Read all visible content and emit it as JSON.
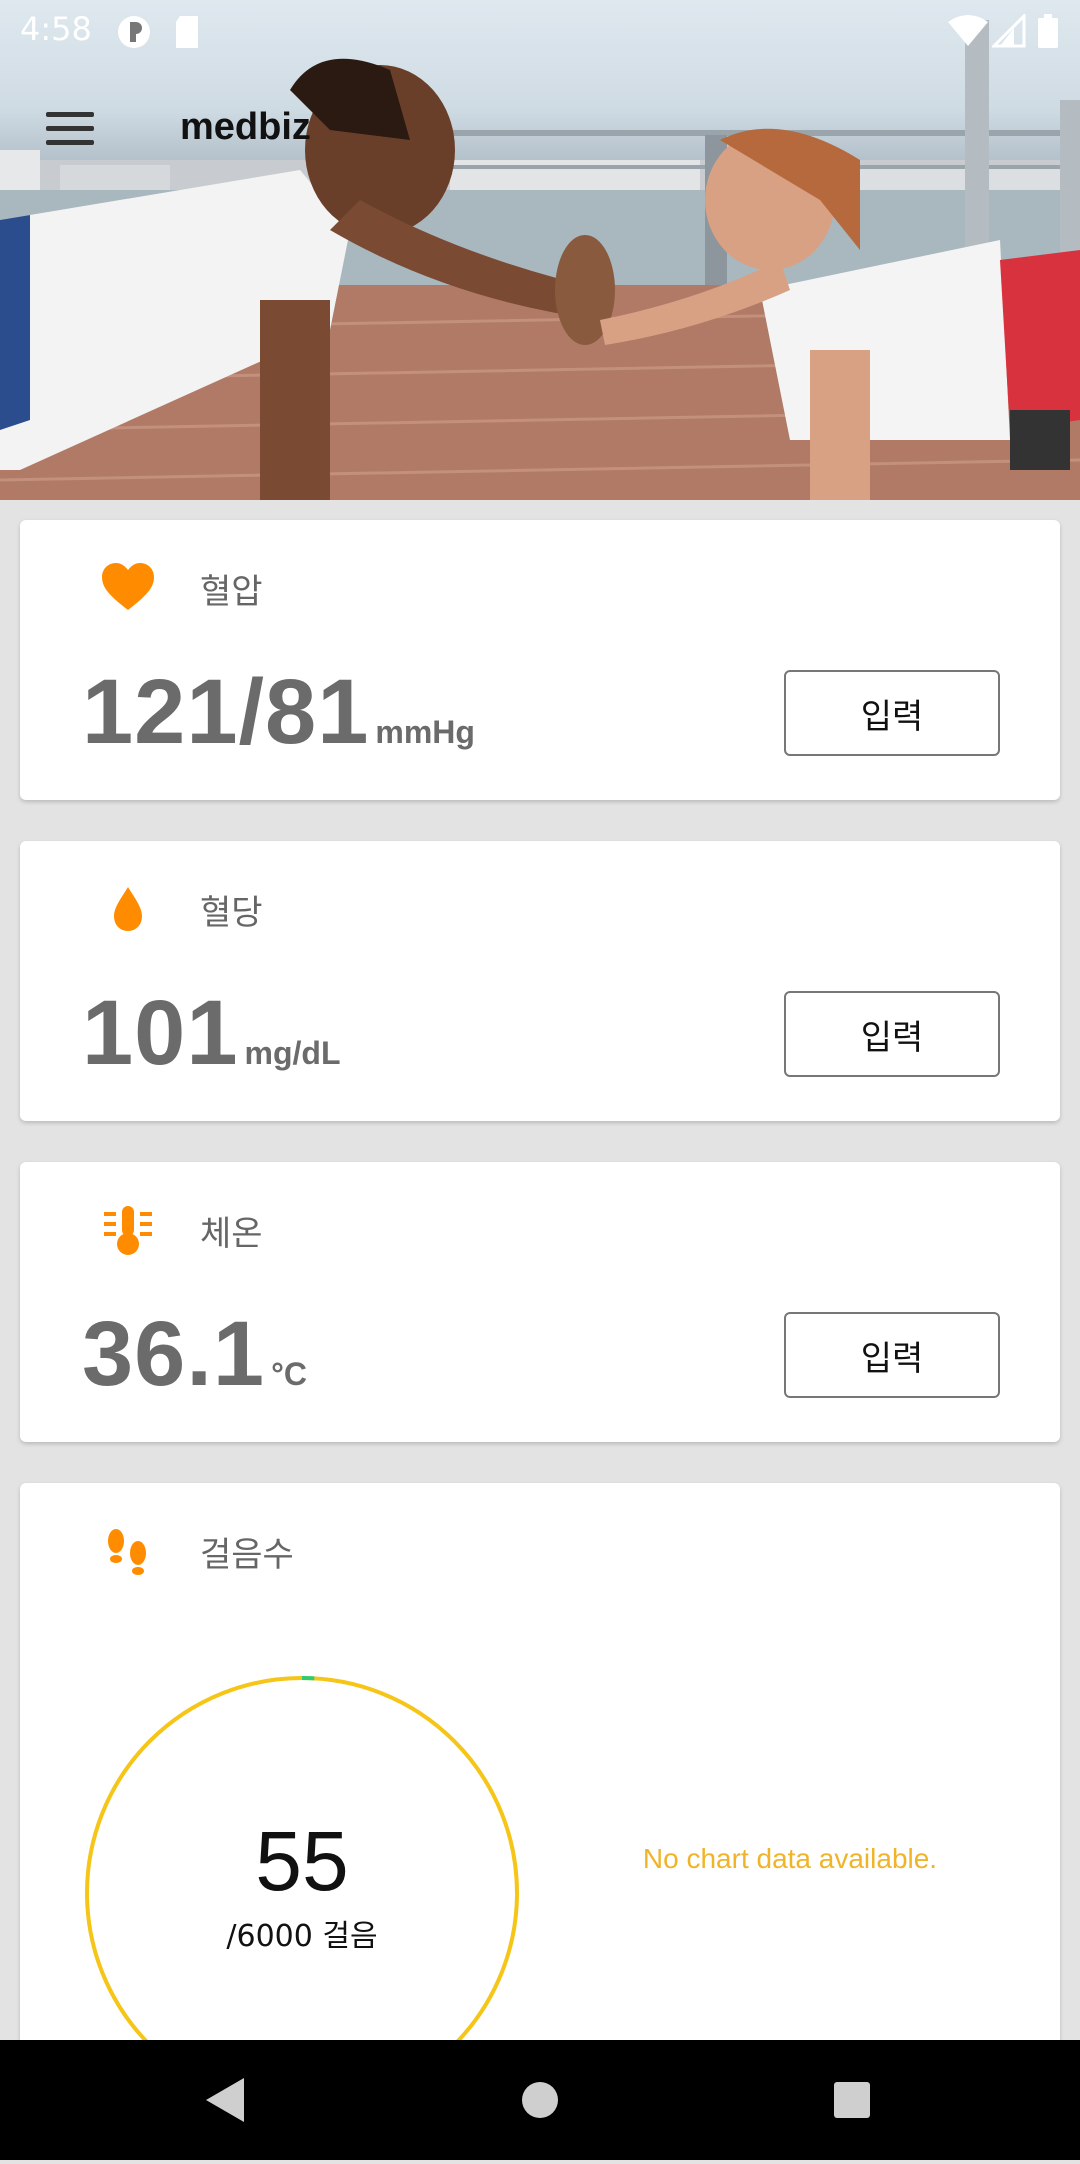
{
  "status_bar": {
    "time": "4:58"
  },
  "app_bar": {
    "title": "medbiz"
  },
  "colors": {
    "accent": "#ff8c00",
    "ring": "#f5c518",
    "ring_progress": "#2ecc71",
    "no_data": "#f0b429"
  },
  "cards": {
    "blood_pressure": {
      "label": "혈압",
      "value": "121/81",
      "unit": "mmHg",
      "button": "입력",
      "icon": "heart-icon"
    },
    "blood_sugar": {
      "label": "혈당",
      "value": "101",
      "unit": "mg/dL",
      "button": "입력",
      "icon": "drop-icon"
    },
    "temperature": {
      "label": "체온",
      "value": "36.1",
      "unit": "°C",
      "button": "입력",
      "icon": "thermometer-icon"
    },
    "steps": {
      "label": "걸음수",
      "count": "55",
      "goal": "/6000 걸음",
      "progress": 0.0092,
      "no_data": "No chart data available.",
      "icon": "footprints-icon"
    }
  }
}
